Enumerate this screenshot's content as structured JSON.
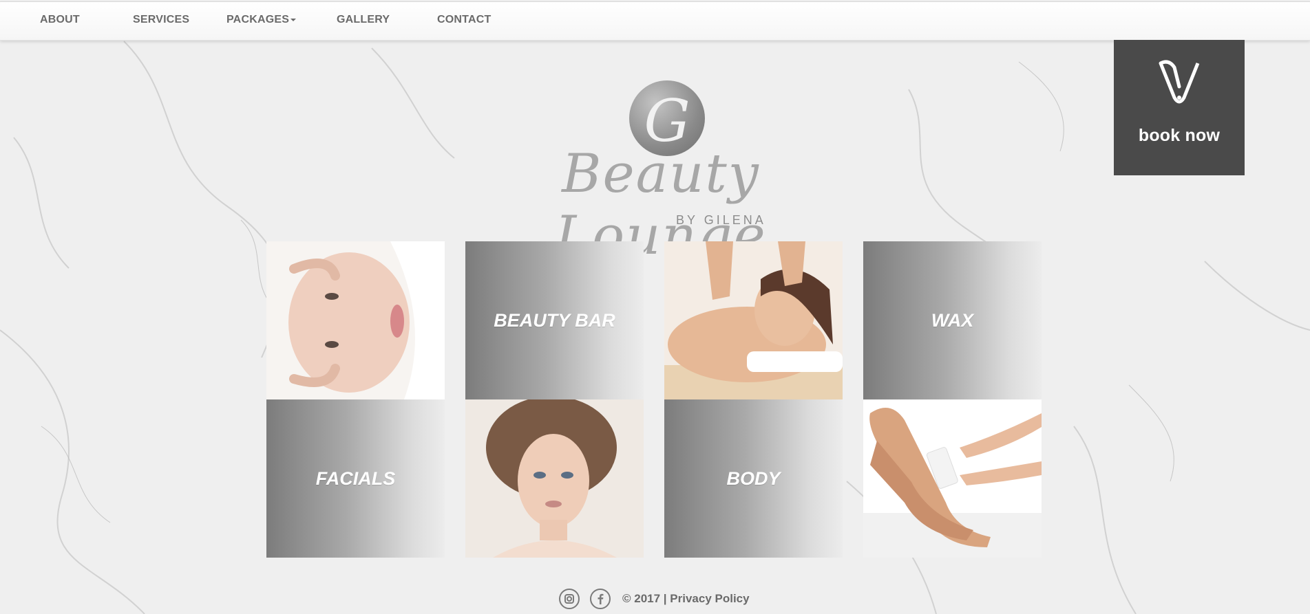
{
  "nav": {
    "items": [
      {
        "label": "ABOUT"
      },
      {
        "label": "SERVICES"
      },
      {
        "label": "PACKAGES",
        "has_dropdown": true
      },
      {
        "label": "GALLERY"
      },
      {
        "label": "CONTACT"
      }
    ]
  },
  "booking": {
    "label": "book now",
    "icon": "v-tag-icon",
    "background": "#4a4a4a"
  },
  "logo": {
    "monogram": "G",
    "title": "Beauty Lounge",
    "subtitle": "BY GILENA"
  },
  "tiles": [
    {
      "type": "image",
      "icon": "face-treatment-photo"
    },
    {
      "type": "label",
      "label": "BEAUTY BAR"
    },
    {
      "type": "image",
      "icon": "massage-photo"
    },
    {
      "type": "label",
      "label": "WAX"
    },
    {
      "type": "label",
      "label": "FACIALS"
    },
    {
      "type": "image",
      "icon": "makeup-portrait-photo"
    },
    {
      "type": "label",
      "label": "BODY"
    },
    {
      "type": "image",
      "icon": "leg-wax-photo"
    }
  ],
  "footer": {
    "copyright": "© 2017 |",
    "privacy": "Privacy Policy",
    "icons": [
      "instagram-icon",
      "facebook-icon"
    ]
  },
  "colors": {
    "nav_text": "#6a6a6a",
    "tile_gradient_dark": "#7c7c7c",
    "tile_gradient_light": "#ececec"
  }
}
